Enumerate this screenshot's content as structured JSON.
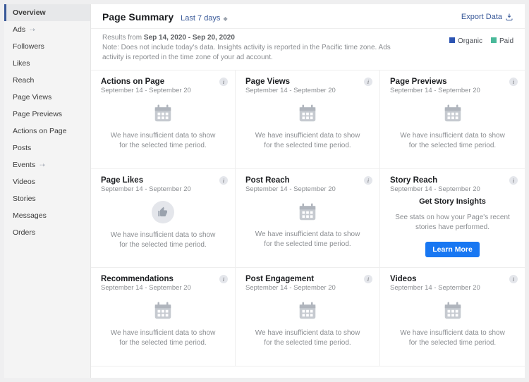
{
  "sidebar": {
    "items": [
      {
        "label": "Overview",
        "selected": true
      },
      {
        "label": "Ads",
        "icon": true
      },
      {
        "label": "Followers"
      },
      {
        "label": "Likes"
      },
      {
        "label": "Reach"
      },
      {
        "label": "Page Views"
      },
      {
        "label": "Page Previews"
      },
      {
        "label": "Actions on Page"
      },
      {
        "label": "Posts"
      },
      {
        "label": "Events",
        "icon": true
      },
      {
        "label": "Videos"
      },
      {
        "label": "Stories"
      },
      {
        "label": "Messages"
      },
      {
        "label": "Orders"
      }
    ]
  },
  "header": {
    "title": "Page Summary",
    "range": "Last 7 days",
    "export_label": "Export Data"
  },
  "subheader": {
    "prefix": "Results from ",
    "range": "Sep 14, 2020 - Sep 20, 2020",
    "note": "Note: Does not include today's data. Insights activity is reported in the Pacific time zone. Ads activity is reported in the time zone of your ad account.",
    "legend": {
      "organic": "Organic",
      "paid": "Paid"
    }
  },
  "card_date_range": "September 14 - September 20",
  "insufficient_msg": "We have insufficient data to show for the selected time period.",
  "story": {
    "title": "Story Reach",
    "cta_title": "Get Story Insights",
    "cta_msg": "See stats on how your Page's recent stories have performed.",
    "button": "Learn More"
  },
  "cards": [
    {
      "title": "Actions on Page"
    },
    {
      "title": "Page Views"
    },
    {
      "title": "Page Previews"
    },
    {
      "title": "Page Likes"
    },
    {
      "title": "Post Reach"
    },
    {
      "title": "Story Reach"
    },
    {
      "title": "Recommendations"
    },
    {
      "title": "Post Engagement"
    },
    {
      "title": "Videos"
    }
  ]
}
